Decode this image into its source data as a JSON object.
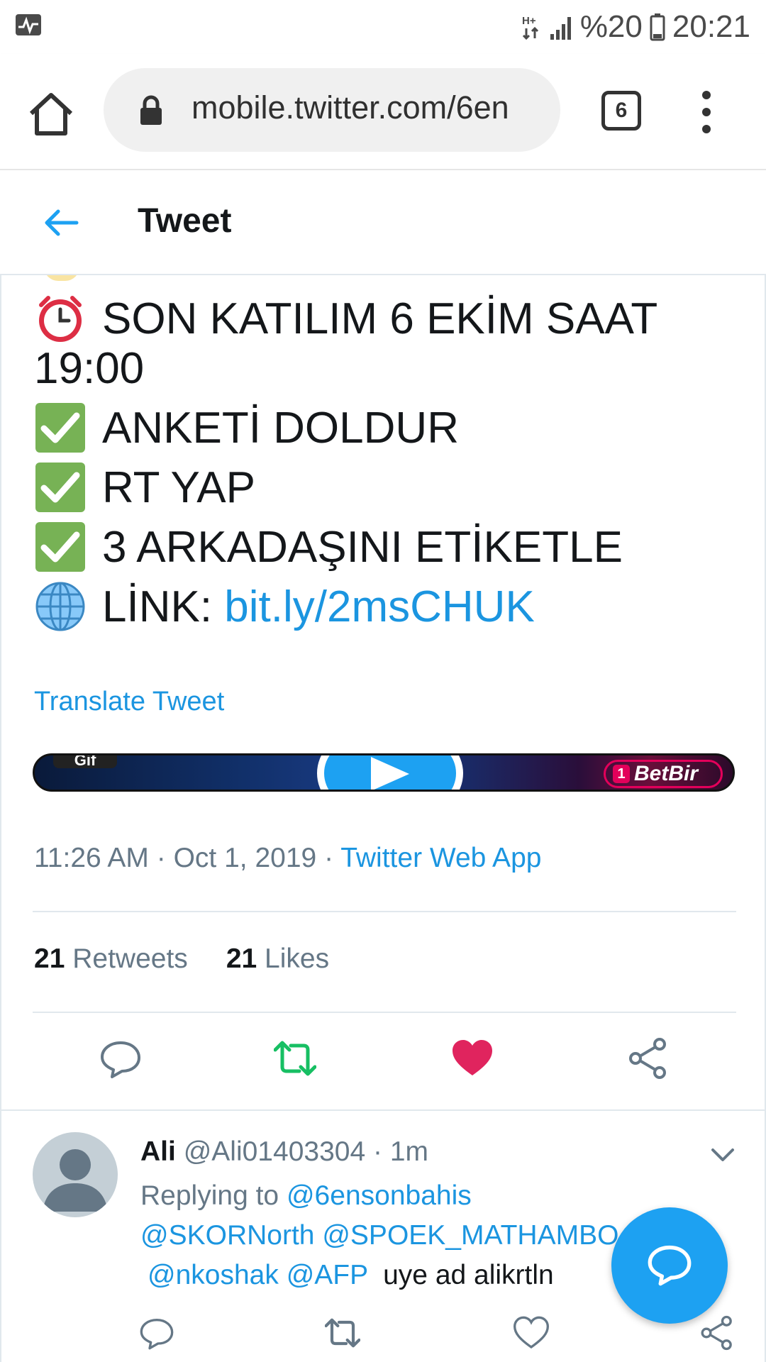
{
  "status_bar": {
    "network": "H+",
    "battery_text": "%20",
    "time": "20:21"
  },
  "browser": {
    "url": "mobile.twitter.com/6en",
    "tab_count": "6"
  },
  "header": {
    "title": "Tweet"
  },
  "tweet": {
    "lines": [
      {
        "text": "SON KATILIM 6 EKİM SAAT",
        "icon": "alarm-clock-icon"
      },
      {
        "text": "19:00"
      },
      {
        "text": "ANKETİ DOLDUR",
        "icon": "check-mark-icon"
      },
      {
        "text": "RT YAP",
        "icon": "check-mark-icon"
      },
      {
        "text": "3 ARKADAŞINI ETİKETLE",
        "icon": "check-mark-icon"
      },
      {
        "text": "LİNK: ",
        "link": "bit.ly/2msCHUK",
        "icon": "globe-icon"
      }
    ],
    "translate_label": "Translate Tweet",
    "media": {
      "tag": "Gif",
      "brand": "BetBir",
      "brand_mark": "1"
    },
    "time": "11:26 AM",
    "date": "Oct 1, 2019",
    "separator": "·",
    "source": "Twitter Web App",
    "retweets_count": "21",
    "retweets_label": "Retweets",
    "likes_count": "21",
    "likes_label": "Likes"
  },
  "reply": {
    "name": "Ali",
    "handle": "@Ali01403304",
    "separator": "·",
    "time": "1m",
    "replying_to_label": "Replying to",
    "mention_1": "@6ensonbahis",
    "mention_2": "@SKORNorth",
    "mention_3": "@SPOEK_MATHAMBO",
    "mention_4": "@nkoshak",
    "mention_5": "@AFP",
    "text": "uye ad alikrtln"
  },
  "colors": {
    "twitter_blue": "#1da1f2",
    "link_blue": "#1b95e0",
    "retweet_green": "#17bf63",
    "like_red": "#e0245e",
    "muted_gray": "#657786"
  }
}
